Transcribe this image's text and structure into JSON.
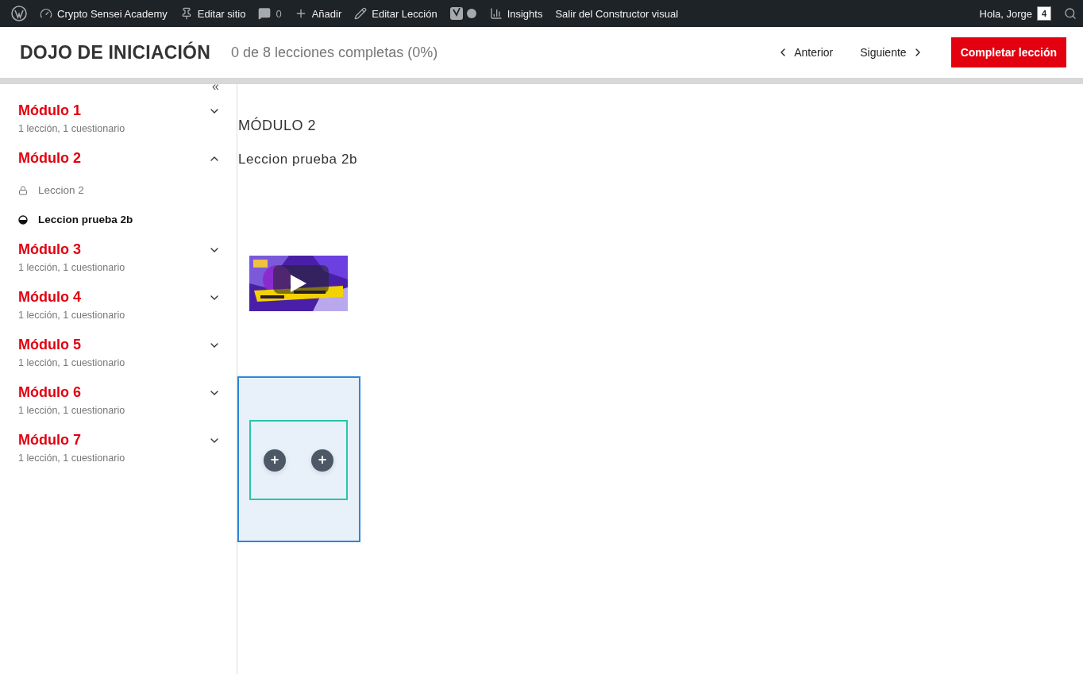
{
  "admin_bar": {
    "items": [
      {
        "kind": "wordpress"
      },
      {
        "kind": "dashboard",
        "label": "Crypto Sensei Academy"
      },
      {
        "kind": "pin",
        "label": "Editar sitio"
      },
      {
        "kind": "comments",
        "label": "0"
      },
      {
        "kind": "plus",
        "label": "Añadir"
      },
      {
        "kind": "pencil",
        "label": "Editar Lección"
      },
      {
        "kind": "yoast"
      },
      {
        "kind": "bars",
        "label": "Insights"
      },
      {
        "kind": "text",
        "label": "Salir del Constructor visual"
      }
    ],
    "greeting": "Hola, Jorge",
    "avatar": "4"
  },
  "header": {
    "course_title": "DOJO DE INICIACIÓN",
    "progress": "0 de 8 lecciones completas (0%)",
    "prev": "Anterior",
    "next": "Siguiente",
    "complete": "Completar lección"
  },
  "sidebar": {
    "collapse": "«",
    "modules": [
      {
        "title": "Módulo 1",
        "summary": "1 lección, 1 cuestionario",
        "expanded": false
      },
      {
        "title": "Módulo 2",
        "expanded": true,
        "lessons": [
          {
            "title": "Leccion 2",
            "kind": "locked",
            "selected": false
          },
          {
            "title": "Leccion prueba 2b",
            "kind": "in_progress",
            "selected": true
          }
        ]
      },
      {
        "title": "Módulo 3",
        "summary": "1 lección, 1 cuestionario",
        "expanded": false
      },
      {
        "title": "Módulo 4",
        "summary": "1 lección, 1 cuestionario",
        "expanded": false
      },
      {
        "title": "Módulo 5",
        "summary": "1 lección, 1 cuestionario",
        "expanded": false
      },
      {
        "title": "Módulo 6",
        "summary": "1 lección, 1 cuestionario",
        "expanded": false
      },
      {
        "title": "Módulo 7",
        "summary": "1 lección, 1 cuestionario",
        "expanded": false
      }
    ]
  },
  "content": {
    "module_heading": "MÓDULO 2",
    "lesson_title": "Leccion prueba 2b",
    "builder_section": {
      "add_buttons": [
        "+",
        "+"
      ]
    }
  }
}
